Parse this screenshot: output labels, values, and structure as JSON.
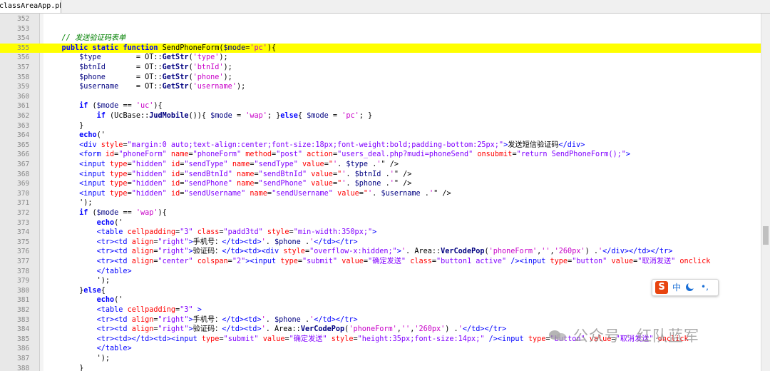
{
  "tab": {
    "label": "classAreaApp.php"
  },
  "ime": {
    "mode": "中",
    "punct": "•,"
  },
  "watermark": {
    "text": "公众号 · 红队蓝军"
  },
  "colors": {
    "highlight_line": "#ffff00",
    "string": "#c800c8",
    "keyword": "#0000ff",
    "comment": "#008000",
    "html_attr": "#ff0000",
    "html_attr_value": "#8000ff"
  },
  "editor": {
    "lines": [
      {
        "n": "352",
        "code": ""
      },
      {
        "n": "353",
        "code": ""
      },
      {
        "n": "354",
        "code": "    // 发送验证码表单"
      },
      {
        "n": "355",
        "code": "    public static function SendPhoneForm($mode='pc'){"
      },
      {
        "n": "356",
        "code": "        $type        = OT::GetStr('type');"
      },
      {
        "n": "357",
        "code": "        $btnId       = OT::GetStr('btnId');"
      },
      {
        "n": "358",
        "code": "        $phone       = OT::GetStr('phone');"
      },
      {
        "n": "359",
        "code": "        $username    = OT::GetStr('username');"
      },
      {
        "n": "360",
        "code": ""
      },
      {
        "n": "361",
        "code": "        if ($mode == 'uc'){"
      },
      {
        "n": "362",
        "code": "            if (UcBase::JudMobile()){ $mode = 'wap'; }else{ $mode = 'pc'; }"
      },
      {
        "n": "363",
        "code": "        }"
      },
      {
        "n": "364",
        "code": "        echo('"
      },
      {
        "n": "365",
        "code": "        <div style=\"margin:0 auto;text-align:center;font-size:18px;font-weight:bold;padding-bottom:25px;\">发送短信验证码</div>"
      },
      {
        "n": "366",
        "code": "        <form id=\"phoneForm\" name=\"phoneForm\" method=\"post\" action=\"users_deal.php?mudi=phoneSend\" onsubmit=\"return SendPhoneForm();\">"
      },
      {
        "n": "367",
        "code": "        <input type=\"hidden\" id=\"sendType\" name=\"sendType\" value=\"'. $type .'\" />"
      },
      {
        "n": "368",
        "code": "        <input type=\"hidden\" id=\"sendBtnId\" name=\"sendBtnId\" value=\"'. $btnId .'\" />"
      },
      {
        "n": "369",
        "code": "        <input type=\"hidden\" id=\"sendPhone\" name=\"sendPhone\" value=\"'. $phone .'\" />"
      },
      {
        "n": "370",
        "code": "        <input type=\"hidden\" id=\"sendUsername\" name=\"sendUsername\" value=\"'. $username .'\" />"
      },
      {
        "n": "371",
        "code": "        ');"
      },
      {
        "n": "372",
        "code": "        if ($mode == 'wap'){"
      },
      {
        "n": "373",
        "code": "            echo('"
      },
      {
        "n": "374",
        "code": "            <table cellpadding=\"3\" class=\"padd3td\" style=\"min-width:350px;\">"
      },
      {
        "n": "375",
        "code": "            <tr><td align=\"right\">手机号：</td><td>'. $phone .'</td></tr>"
      },
      {
        "n": "376",
        "code": "            <tr><td align=\"right\">验证码：</td><td><div style=\"overflow-x:hidden;\">'. Area::VerCodePop('phoneForm','','260px') .'</div></td></tr>"
      },
      {
        "n": "377",
        "code": "            <tr><td align=\"center\" colspan=\"2\"><input type=\"submit\" value=\"确定发送\" class=\"button1 active\" /><input type=\"button\" value=\"取消发送\" onclick"
      },
      {
        "n": "378",
        "code": "            </table>"
      },
      {
        "n": "379",
        "code": "            ');"
      },
      {
        "n": "380",
        "code": "        }else{"
      },
      {
        "n": "381",
        "code": "            echo('"
      },
      {
        "n": "382",
        "code": "            <table cellpadding=\"3\" >"
      },
      {
        "n": "383",
        "code": "            <tr><td align=\"right\">手机号：</td><td>'. $phone .'</td></tr>"
      },
      {
        "n": "384",
        "code": "            <tr><td align=\"right\">验证码：</td><td>'. Area::VerCodePop('phoneForm','','260px') .'</td></tr>"
      },
      {
        "n": "385",
        "code": "            <tr><td></td><td><input type=\"submit\" value=\"确定发送\" style=\"height:35px;font-size:14px;\" /><input type=\"button\" value=\"取消发送\" onclick"
      },
      {
        "n": "386",
        "code": "            </table>"
      },
      {
        "n": "387",
        "code": "            ');"
      },
      {
        "n": "388",
        "code": "        }"
      }
    ],
    "current_line": "355"
  }
}
